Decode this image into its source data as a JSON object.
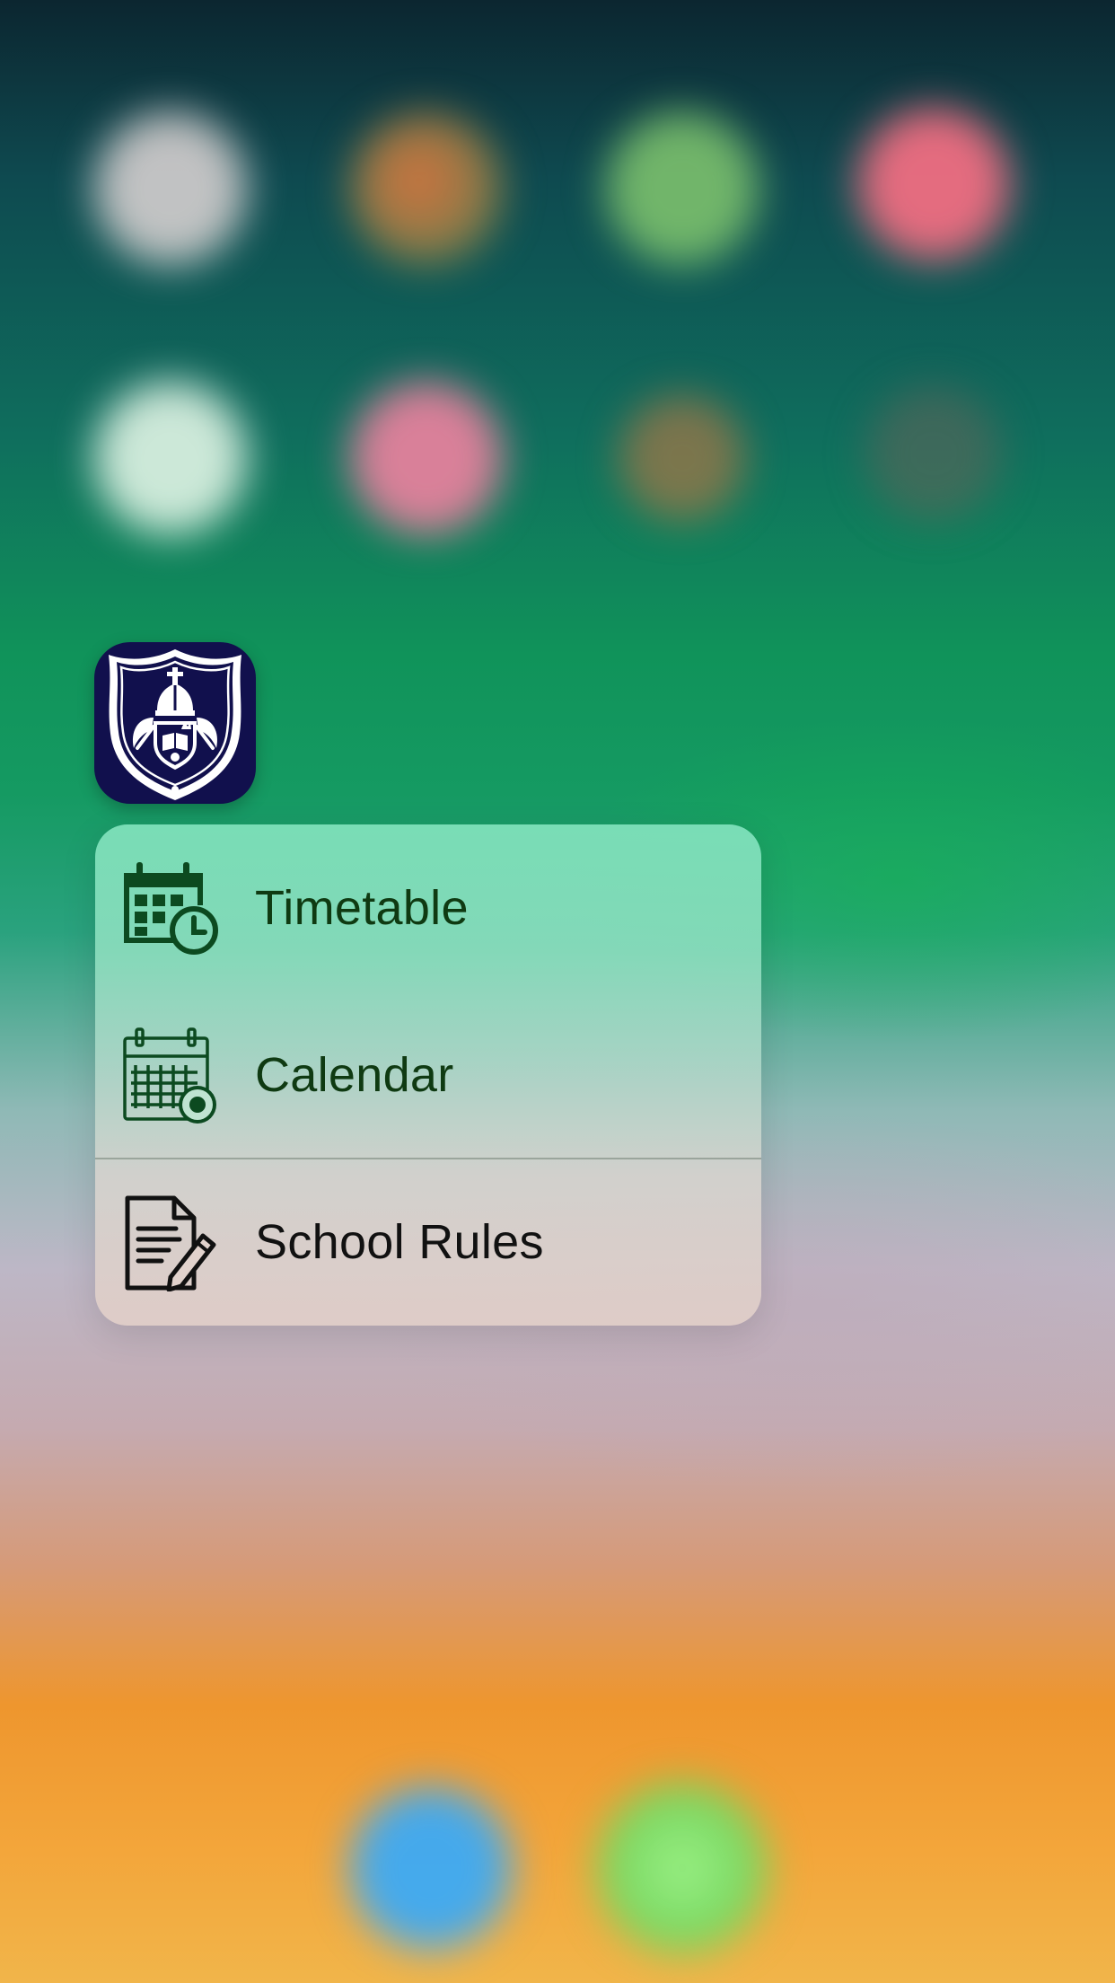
{
  "app": {
    "icon_name": "school-crest-icon",
    "icon_bg_color": "#11104d"
  },
  "quick_actions": {
    "items": [
      {
        "label": "Timetable",
        "icon": "calendar-clock-icon",
        "text_color": "#0f3a12"
      },
      {
        "label": "Calendar",
        "icon": "calendar-grid-icon",
        "text_color": "#0f3a12"
      },
      {
        "label": "School Rules",
        "icon": "document-pencil-icon",
        "text_color": "#111111"
      }
    ]
  },
  "colors": {
    "icon_green": "#0c4a20",
    "icon_black": "#111111"
  }
}
